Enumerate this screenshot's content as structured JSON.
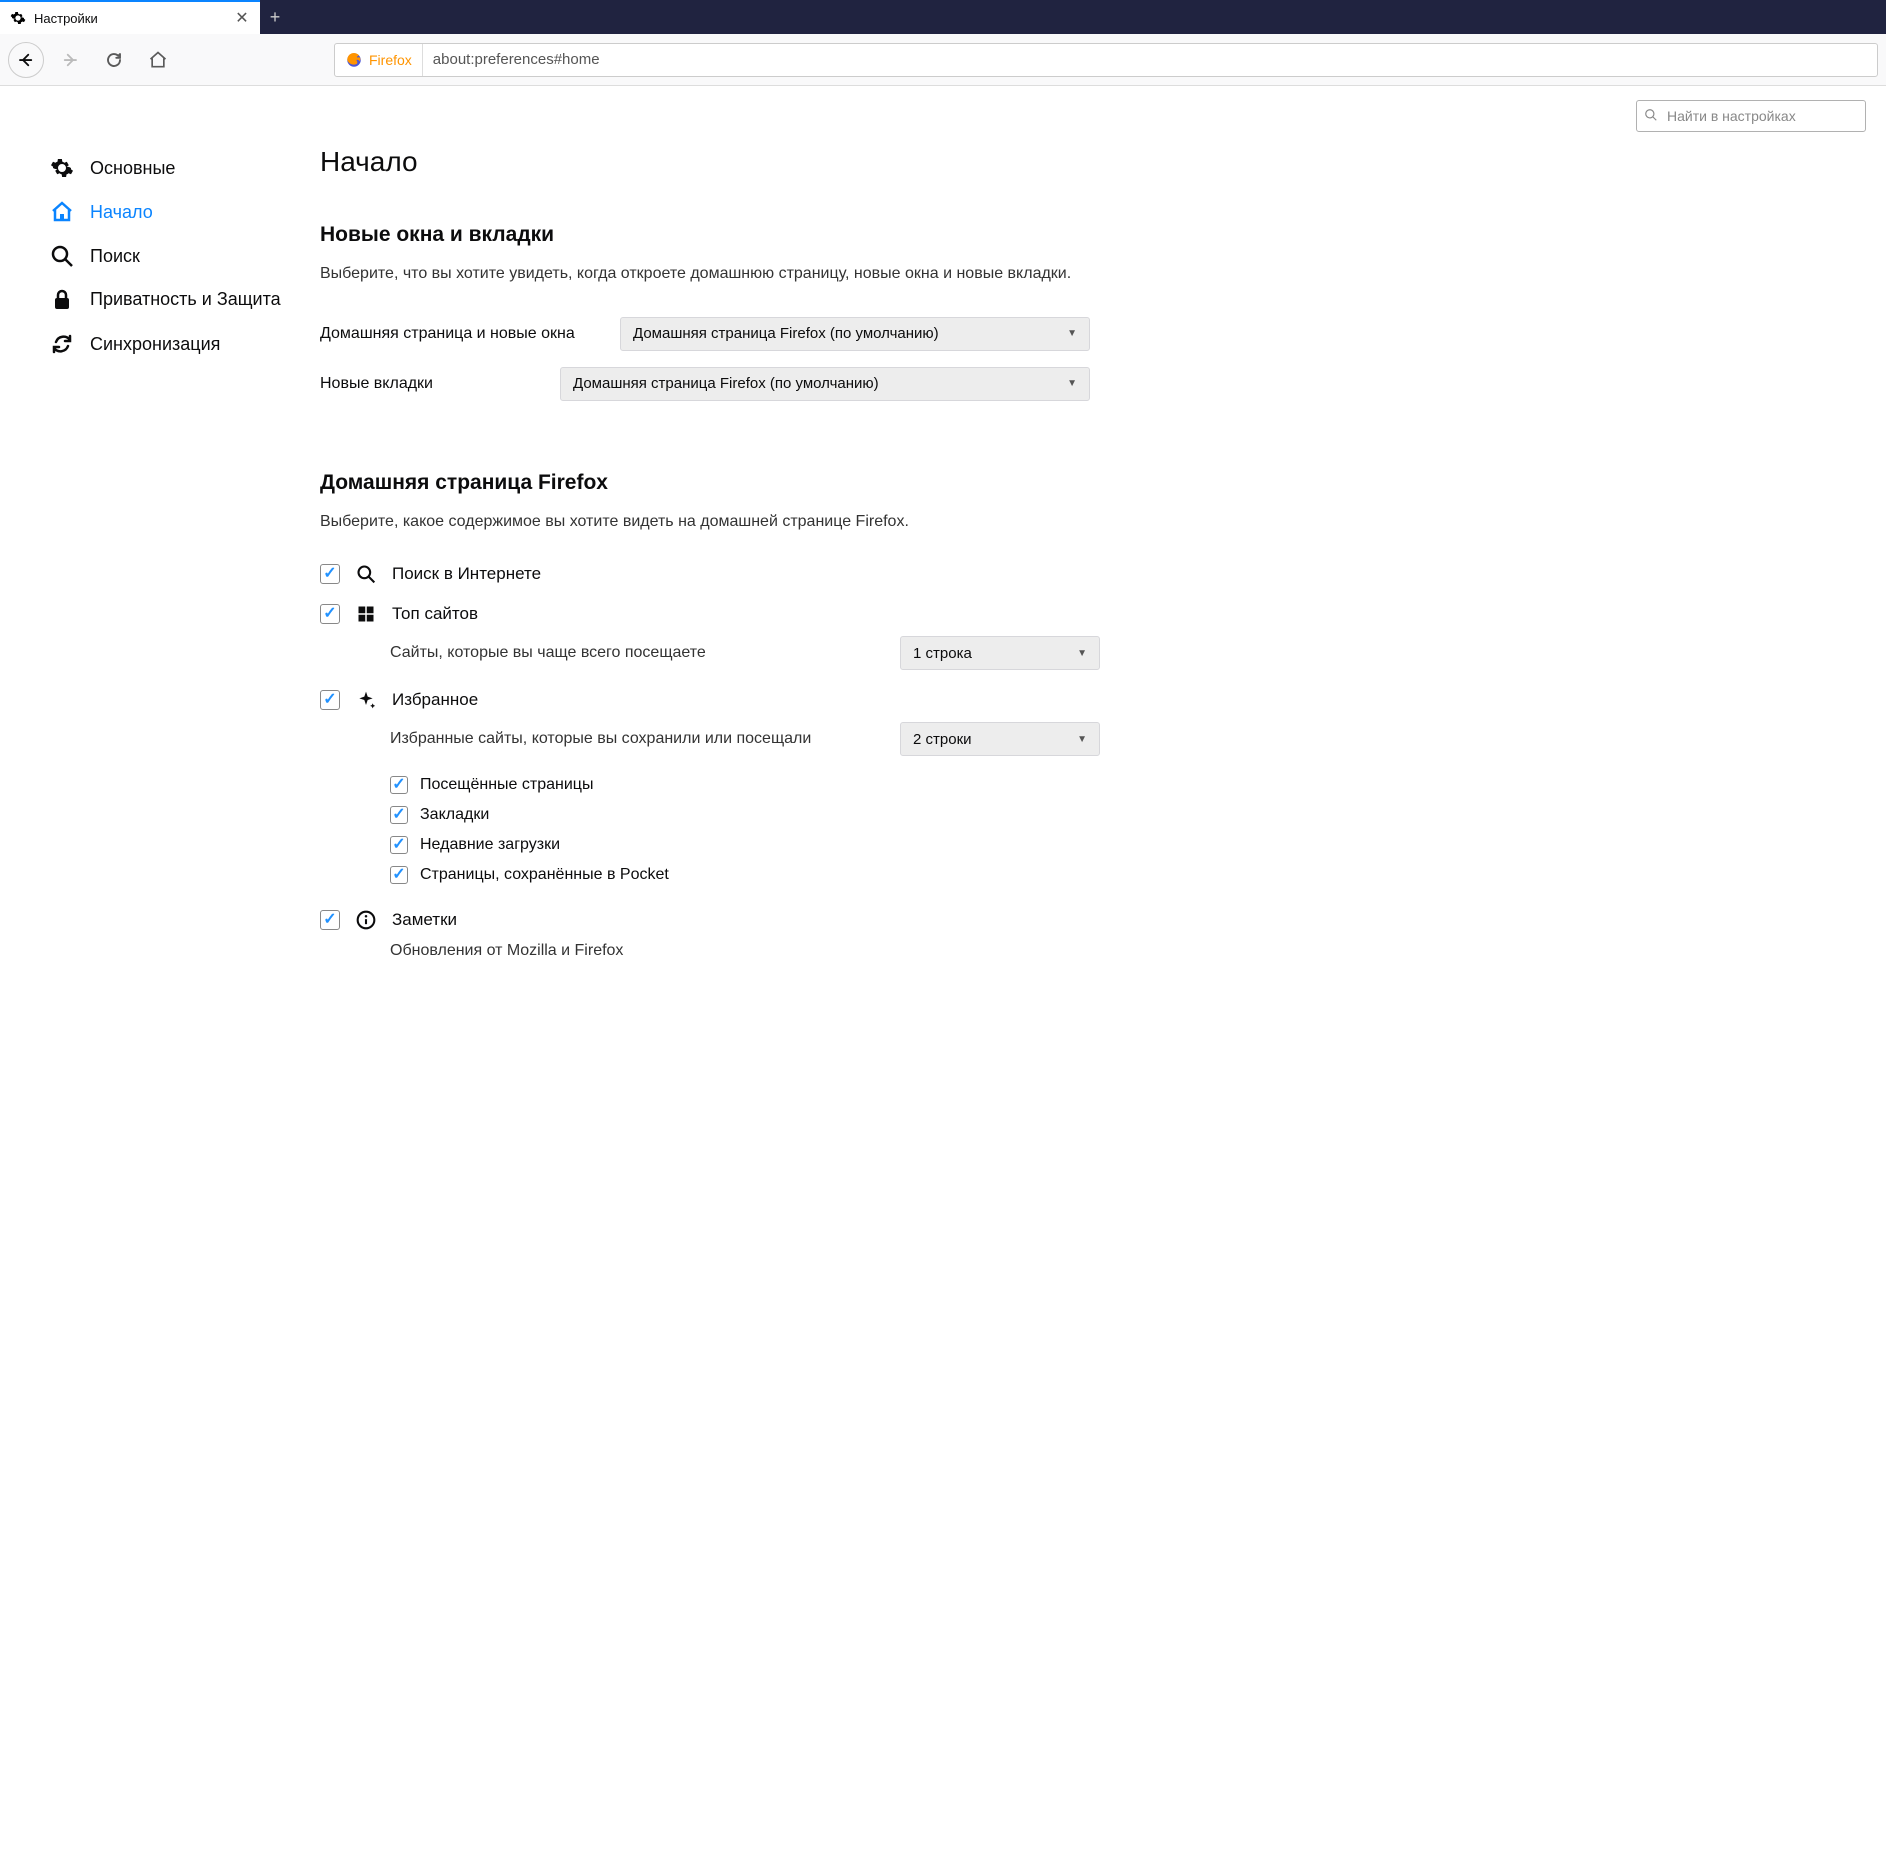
{
  "browser": {
    "tab_title": "Настройки",
    "identity_label": "Firefox",
    "url": "about:preferences#home"
  },
  "search": {
    "placeholder": "Найти в настройках"
  },
  "sidebar": {
    "general": "Основные",
    "home": "Начало",
    "search": "Поиск",
    "privacy": "Приватность и Защита",
    "sync": "Синхронизация"
  },
  "page": {
    "title": "Начало",
    "new_windows_tabs": {
      "heading": "Новые окна и вкладки",
      "desc": "Выберите, что вы хотите увидеть, когда откроете домашнюю страницу, новые окна и новые вкладки.",
      "homepage_label": "Домашняя страница и новые окна",
      "homepage_value": "Домашняя страница Firefox (по умолчанию)",
      "newtab_label": "Новые вкладки",
      "newtab_value": "Домашняя страница Firefox (по умолчанию)"
    },
    "firefox_home": {
      "heading": "Домашняя страница Firefox",
      "desc": "Выберите, какое содержимое вы хотите видеть на домашней странице Firefox.",
      "web_search": "Поиск в Интернете",
      "top_sites": {
        "title": "Топ сайтов",
        "desc": "Сайты, которые вы чаще всего посещаете",
        "rows_value": "1 строка"
      },
      "highlights": {
        "title": "Избранное",
        "desc": "Избранные сайты, которые вы сохранили или посещали",
        "rows_value": "2 строки",
        "visited": "Посещённые страницы",
        "bookmarks": "Закладки",
        "downloads": "Недавние загрузки",
        "pocket": "Страницы, сохранённые в Pocket"
      },
      "snippets": {
        "title": "Заметки",
        "desc": "Обновления от Mozilla и Firefox"
      }
    }
  }
}
